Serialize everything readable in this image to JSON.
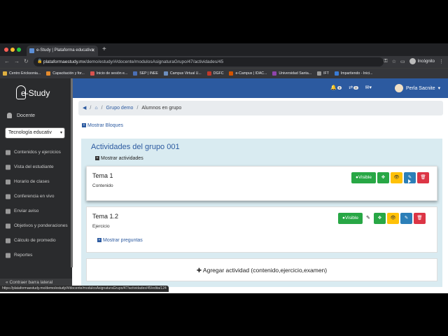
{
  "browser": {
    "tab_title": "e-Study | Plataforma educativa",
    "address_host": "plataformaestudy.mx",
    "address_path": "/demo/estudy/#/docente/modulosAsignaturaGrupo/47/actividades/45",
    "incognito_label": "Incógnito",
    "bookmarks": [
      {
        "label": "Centro Ericksonia...",
        "color": "#e0b040"
      },
      {
        "label": "Capacitación y for...",
        "color": "#e58b2d"
      },
      {
        "label": "Inicio de sesión e...",
        "color": "#d9534f"
      },
      {
        "label": "SEP | INEE",
        "color": "#4b6fb5"
      },
      {
        "label": "Campus Virtual U...",
        "color": "#6c8ebf"
      },
      {
        "label": "DGFC",
        "color": "#c0392b"
      },
      {
        "label": "e-Campus | IDAC...",
        "color": "#d35400"
      },
      {
        "label": "Universidad Santa...",
        "color": "#8e44ad"
      },
      {
        "label": "IFT",
        "color": "#999999"
      },
      {
        "label": "Impartiendo - Inici...",
        "color": "#3a7bd5"
      }
    ],
    "status_url": "https://plataformaestudy.mx/demo/estudy/#/docente/modulosAsignaturaGrupo/47/actividades/45/edita/124"
  },
  "sidebar": {
    "logo_text": "e-Study",
    "user_label": "Docente",
    "subject_select": "Tecnología educativ",
    "items": [
      {
        "label": "Contenidos y ejercicios"
      },
      {
        "label": "Vista del estudiante"
      },
      {
        "label": "Horario de clases"
      },
      {
        "label": "Conferencia en vivo"
      },
      {
        "label": "Enviar aviso"
      },
      {
        "label": "Objetivos y ponderaciones"
      },
      {
        "label": "Cálculo de promedio"
      },
      {
        "label": "Reportes"
      }
    ],
    "collapse_label": "Contraer barra lateral"
  },
  "topnav": {
    "bell_badge": "0",
    "tasks_badge": "0",
    "user_name": "Perla Sacnite"
  },
  "breadcrumb": {
    "group": "Grupo demo",
    "current": "Alumnos en grupo"
  },
  "main": {
    "show_blocks": "Mostrar Bloques",
    "group_title": "Actividades del grupo 001",
    "show_activities": "Mostrar actividades",
    "activities": [
      {
        "title": "Tema 1",
        "type": "Contenido",
        "visible_label": "Visible"
      },
      {
        "title": "Tema 1.2",
        "type": "Ejercicio",
        "visible_label": "Visible",
        "show_questions": "Mostrar preguntas"
      }
    ],
    "add_activity": "Agregar actividad (contenido,ejercicio,examen)"
  },
  "colors": {
    "primary": "#2c5aa0",
    "sidebar_bg": "#2a2b2d",
    "success": "#28a745",
    "warning": "#ffc107",
    "danger": "#dc3545",
    "info": "#2c7fb8"
  }
}
